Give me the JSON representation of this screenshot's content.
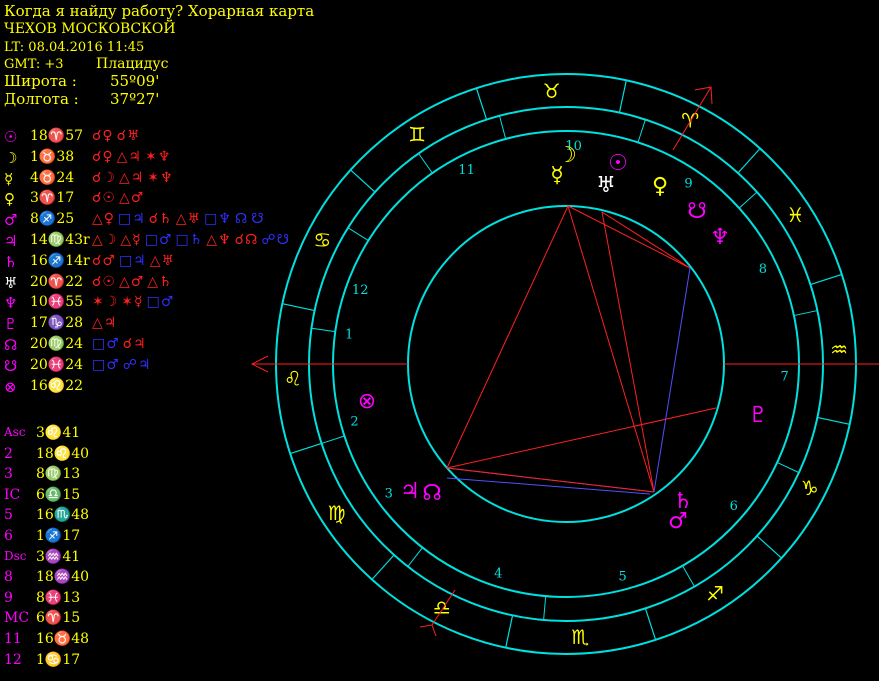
{
  "header": {
    "title": "Когда я найду работу? Хорарная карта",
    "place": "ЧЕХОВ МОСКОВСКОЙ",
    "lt": "LT: 08.04.2016  11:45",
    "gmt": "GMT: +3",
    "system": "Плацидус",
    "lat_label": "Широта :",
    "lat_value": "55º09'",
    "lon_label": "Долгота :",
    "lon_value": "37º27'"
  },
  "planets": [
    {
      "glyph": "☉",
      "color": "#ff00ff",
      "pos": "18♈57",
      "aspects": [
        {
          "t": "☌♀",
          "c": "#ff2020"
        },
        {
          "t": "☌♅",
          "c": "#ff2020"
        }
      ]
    },
    {
      "glyph": "☽",
      "color": "#ffff00",
      "pos": "1♉38",
      "aspects": [
        {
          "t": "☌♀",
          "c": "#ff2020"
        },
        {
          "t": "△♃",
          "c": "#ff2020"
        },
        {
          "t": "✶♆",
          "c": "#ff2020"
        }
      ]
    },
    {
      "glyph": "☿",
      "color": "#ffff00",
      "pos": "4♉24",
      "aspects": [
        {
          "t": "☌☽",
          "c": "#ff2020"
        },
        {
          "t": "△♃",
          "c": "#ff2020"
        },
        {
          "t": "✶♆",
          "c": "#ff2020"
        }
      ]
    },
    {
      "glyph": "♀",
      "color": "#ffff00",
      "pos": "3♈17",
      "aspects": [
        {
          "t": "☌☉",
          "c": "#ff2020"
        },
        {
          "t": "△♂",
          "c": "#ff2020"
        }
      ]
    },
    {
      "glyph": "♂",
      "color": "#ff00ff",
      "pos": "8♐25",
      "aspects": [
        {
          "t": "△♀",
          "c": "#ff2020"
        },
        {
          "t": "□♃",
          "c": "#3030ff"
        },
        {
          "t": "☌♄",
          "c": "#ff2020"
        },
        {
          "t": "△♅",
          "c": "#ff2020"
        },
        {
          "t": "□♆",
          "c": "#3030ff"
        },
        {
          "t": "☊",
          "c": "#3030ff"
        },
        {
          "t": "☋",
          "c": "#3030ff"
        }
      ]
    },
    {
      "glyph": "♃",
      "color": "#ff00ff",
      "pos": "14♍43r",
      "aspects": [
        {
          "t": "△☽",
          "c": "#ff2020"
        },
        {
          "t": "△☿",
          "c": "#ff2020"
        },
        {
          "t": "□♂",
          "c": "#3030ff"
        },
        {
          "t": "□♄",
          "c": "#3030ff"
        },
        {
          "t": "△♆",
          "c": "#ff2020"
        },
        {
          "t": "☌☊",
          "c": "#ff2020"
        },
        {
          "t": "☍☋",
          "c": "#3030ff"
        }
      ]
    },
    {
      "glyph": "♄",
      "color": "#ff00ff",
      "pos": "16♐14r",
      "aspects": [
        {
          "t": "☌♂",
          "c": "#ff2020"
        },
        {
          "t": "□♃",
          "c": "#3030ff"
        },
        {
          "t": "△♅",
          "c": "#ff2020"
        }
      ]
    },
    {
      "glyph": "♅",
      "color": "#ffffff",
      "pos": "20♈22",
      "aspects": [
        {
          "t": "☌☉",
          "c": "#ff2020"
        },
        {
          "t": "△♂",
          "c": "#ff2020"
        },
        {
          "t": "△♄",
          "c": "#ff2020"
        }
      ]
    },
    {
      "glyph": "♆",
      "color": "#ff00ff",
      "pos": "10♓55",
      "aspects": [
        {
          "t": "✶☽",
          "c": "#ff2020"
        },
        {
          "t": "✶☿",
          "c": "#ff2020"
        },
        {
          "t": "□♂",
          "c": "#3030ff"
        }
      ]
    },
    {
      "glyph": "♇",
      "color": "#ff00ff",
      "pos": "17♑28",
      "aspects": [
        {
          "t": "△♃",
          "c": "#ff2020"
        }
      ]
    },
    {
      "glyph": "☊",
      "color": "#ff00ff",
      "pos": "20♍24",
      "aspects": [
        {
          "t": "□♂",
          "c": "#3030ff"
        },
        {
          "t": "☌♃",
          "c": "#ff2020"
        }
      ]
    },
    {
      "glyph": "☋",
      "color": "#ff00ff",
      "pos": "20♓24",
      "aspects": [
        {
          "t": "□♂",
          "c": "#3030ff"
        },
        {
          "t": "☍♃",
          "c": "#3030ff"
        }
      ]
    },
    {
      "glyph": "⊗",
      "color": "#ff00ff",
      "pos": "16♌22",
      "aspects": []
    }
  ],
  "cusps": [
    {
      "label": "Asc",
      "value": "3♌41"
    },
    {
      "label": "2",
      "value": "18♌40"
    },
    {
      "label": "3",
      "value": "8♍13"
    },
    {
      "label": "IC",
      "value": "6♎15"
    },
    {
      "label": "5",
      "value": "16♏48"
    },
    {
      "label": "6",
      "value": "1♐17"
    },
    {
      "label": "Dsc",
      "value": "3♒41"
    },
    {
      "label": "8",
      "value": "18♒40"
    },
    {
      "label": "9",
      "value": "8♓13"
    },
    {
      "label": "MC",
      "value": "6♈15"
    },
    {
      "label": "11",
      "value": "16♉48"
    },
    {
      "label": "12",
      "value": "1♋17"
    }
  ],
  "wheel": {
    "ring_color": "#00e0e0",
    "zodiac_signs": [
      {
        "g": "♉"
      },
      {
        "g": "♈"
      },
      {
        "g": "♓"
      },
      {
        "g": "♒"
      },
      {
        "g": "♑"
      },
      {
        "g": "♐"
      },
      {
        "g": "♏"
      },
      {
        "g": "♎"
      },
      {
        "g": "♍"
      },
      {
        "g": "♌"
      },
      {
        "g": "♋"
      },
      {
        "g": "♊"
      }
    ],
    "house_numbers": [
      "10",
      "9",
      "8",
      "7",
      "6",
      "5",
      "4",
      "3",
      "2",
      "1",
      "12",
      "11"
    ],
    "chart_planets": [
      {
        "g": "☽",
        "c": "#ffff00"
      },
      {
        "g": "☉",
        "c": "#ff00ff"
      },
      {
        "g": "☿",
        "c": "#ffff00"
      },
      {
        "g": "♅",
        "c": "#ffffff"
      },
      {
        "g": "♀",
        "c": "#ffff00"
      },
      {
        "g": "☋",
        "c": "#ff00ff"
      },
      {
        "g": "♆",
        "c": "#ff00ff"
      },
      {
        "g": "♇",
        "c": "#ff00ff"
      },
      {
        "g": "♄",
        "c": "#ff00ff"
      },
      {
        "g": "♂",
        "c": "#ff00ff"
      },
      {
        "g": "♃",
        "c": "#ff00ff"
      },
      {
        "g": "☊",
        "c": "#ff00ff"
      },
      {
        "g": "⊗",
        "c": "#ff00ff"
      }
    ]
  }
}
